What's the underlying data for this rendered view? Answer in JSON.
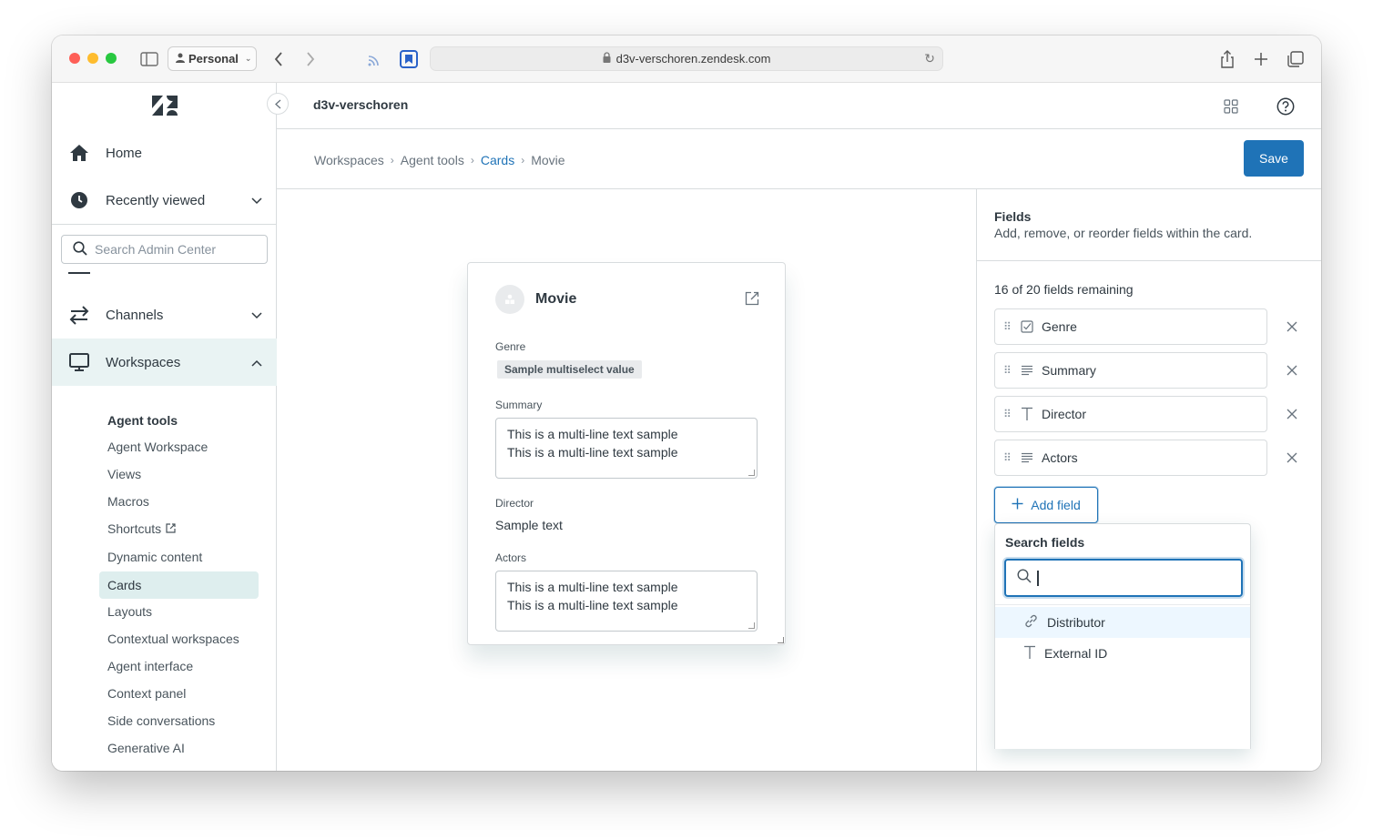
{
  "browser": {
    "profile_label": "Personal",
    "url": "d3v-verschoren.zendesk.com"
  },
  "header": {
    "brand": "d3v-verschoren"
  },
  "sidebar": {
    "home": "Home",
    "recently_viewed": "Recently viewed",
    "search_placeholder": "Search Admin Center",
    "channels": "Channels",
    "workspaces": "Workspaces",
    "sub_items": [
      "Agent tools",
      "Agent Workspace",
      "Views",
      "Macros",
      "Shortcuts",
      "Dynamic content",
      "Cards",
      "Layouts",
      "Contextual workspaces",
      "Agent interface",
      "Context panel",
      "Side conversations",
      "Generative AI"
    ],
    "selected_sub_item": "Cards"
  },
  "breadcrumb": [
    "Workspaces",
    "Agent tools",
    "Cards",
    "Movie"
  ],
  "toolbar": {
    "save_label": "Save"
  },
  "card": {
    "title": "Movie",
    "genre_label": "Genre",
    "genre_value": "Sample multiselect value",
    "summary_label": "Summary",
    "summary_line1": "This is a multi-line text sample",
    "summary_line2": "This is a multi-line text sample",
    "director_label": "Director",
    "director_value": "Sample text",
    "actors_label": "Actors",
    "actors_line1": "This is a multi-line text sample",
    "actors_line2": "This is a multi-line text sample"
  },
  "fields_panel": {
    "title": "Fields",
    "description": "Add, remove, or reorder fields within the card.",
    "remaining": "16 of 20 fields remaining",
    "fields": [
      {
        "label": "Genre",
        "icon": "checkbox-icon"
      },
      {
        "label": "Summary",
        "icon": "multiline-icon"
      },
      {
        "label": "Director",
        "icon": "text-icon"
      },
      {
        "label": "Actors",
        "icon": "multiline-icon"
      }
    ],
    "add_field_label": "Add field",
    "search_title": "Search fields",
    "search_value": "",
    "options": [
      {
        "label": "Distributor",
        "icon": "link-icon"
      },
      {
        "label": "External ID",
        "icon": "text-icon"
      }
    ]
  },
  "colors": {
    "accent": "#1f73b7",
    "nav_selected": "#e9f3f3"
  }
}
